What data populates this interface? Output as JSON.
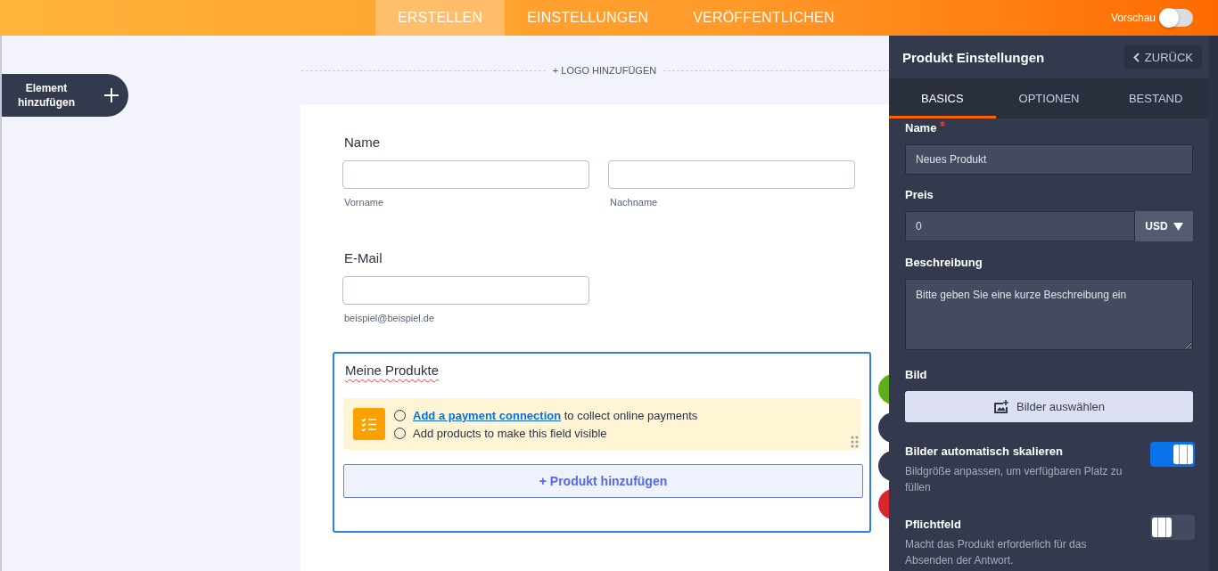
{
  "topbar": {
    "tabs": [
      {
        "label": "ERSTELLEN",
        "selected": true
      },
      {
        "label": "EINSTELLUNGEN",
        "selected": false
      },
      {
        "label": "VERÖFFENTLICHEN",
        "selected": false
      }
    ],
    "preview": {
      "label": "Vorschau",
      "on": false
    }
  },
  "add_element": {
    "label": "Element hinzufügen"
  },
  "logo_link": "+ LOGO HINZUFÜGEN",
  "form": {
    "fields": [
      {
        "label": "Name",
        "inputs": [
          {
            "sublabel": "Vorname"
          },
          {
            "sublabel": "Nachname"
          }
        ]
      },
      {
        "label": "E-Mail",
        "inputs": [
          {
            "sublabel": "beispiel@beispiel.de"
          }
        ]
      }
    ],
    "products": {
      "title": "Meine Produkte",
      "notice": [
        {
          "link": "Add a payment connection",
          "text": "to collect online payments"
        },
        {
          "text": "Add products to make this field visible"
        }
      ],
      "add_button": "+ Produkt hinzufügen"
    },
    "actions": [
      {
        "color": "#5fae1a"
      },
      {
        "color": "#343a4e"
      },
      {
        "color": "#343a4e"
      },
      {
        "color": "#d9262a"
      }
    ]
  },
  "panel": {
    "title": "Produkt Einstellungen",
    "back": "ZURÜCK",
    "tabs": [
      {
        "label": "BASICS",
        "selected": true
      },
      {
        "label": "OPTIONEN",
        "selected": false
      },
      {
        "label": "BESTAND",
        "selected": false
      }
    ],
    "name": {
      "label": "Name",
      "required": true,
      "value": "Neues Produkt"
    },
    "price": {
      "label": "Preis",
      "value": "0",
      "currency": "USD"
    },
    "description": {
      "label": "Beschreibung",
      "placeholder": "Bitte geben Sie eine kurze Beschreibung ein"
    },
    "image": {
      "label": "Bild",
      "button": "Bilder auswählen"
    },
    "toggles": [
      {
        "title": "Bilder automatisch skalieren",
        "description": "Bildgröße anpassen, um verfügbaren Platz zu füllen",
        "on": true
      },
      {
        "title": "Pflichtfeld",
        "description": "Macht das Produkt erforderlich für das Absenden der Antwort.",
        "on": false
      }
    ]
  }
}
